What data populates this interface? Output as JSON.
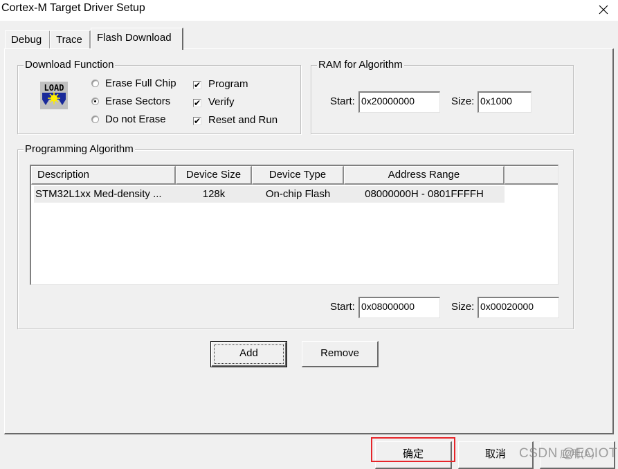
{
  "window": {
    "title": "Cortex-M Target Driver Setup",
    "close_icon": "close-icon"
  },
  "tabs": [
    {
      "label": "Debug",
      "selected": false
    },
    {
      "label": "Trace",
      "selected": false
    },
    {
      "label": "Flash Download",
      "selected": true
    }
  ],
  "download_function": {
    "legend": "Download Function",
    "icon": "load-icon",
    "icon_text": "LOAD",
    "erase_options": [
      {
        "label": "Erase Full Chip",
        "selected": false
      },
      {
        "label": "Erase Sectors",
        "selected": true
      },
      {
        "label": "Do not Erase",
        "selected": false
      }
    ],
    "checks": [
      {
        "label": "Program",
        "checked": true
      },
      {
        "label": "Verify",
        "checked": true
      },
      {
        "label": "Reset and Run",
        "checked": true
      }
    ],
    "check_glyph": "✔"
  },
  "ram_for_algorithm": {
    "legend": "RAM for Algorithm",
    "start_label": "Start:",
    "start_value": "0x20000000",
    "size_label": "Size:",
    "size_value": "0x1000"
  },
  "programming_algorithm": {
    "legend": "Programming Algorithm",
    "columns": [
      "Description",
      "Device Size",
      "Device Type",
      "Address Range"
    ],
    "rows": [
      {
        "description": "STM32L1xx Med-density ...",
        "device_size": "128k",
        "device_type": "On-chip Flash",
        "address_range": "08000000H - 0801FFFFH"
      }
    ],
    "start_label": "Start:",
    "start_value": "0x08000000",
    "size_label": "Size:",
    "size_value": "0x00020000",
    "add_label": "Add",
    "remove_label": "Remove"
  },
  "footer": {
    "ok_label": "确定",
    "cancel_label": "取消",
    "apply_label": "应用(A)",
    "highlight_color": "#e6252a"
  },
  "watermark": "CSDN @ECIOT"
}
